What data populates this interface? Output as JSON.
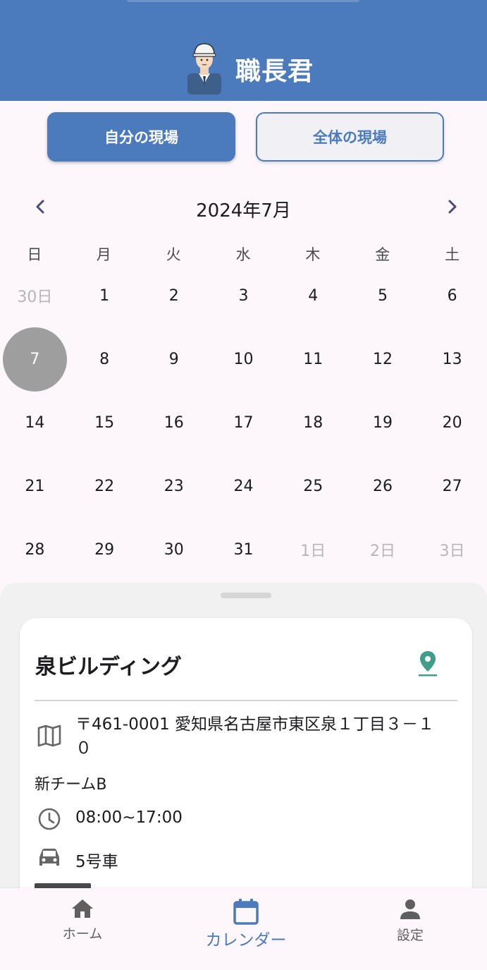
{
  "header": {
    "title": "職長君",
    "avatar_icon": "construction-worker-avatar-icon"
  },
  "tabs": {
    "mine": "自分の現場",
    "all": "全体の現場"
  },
  "calendar": {
    "month_label": "2024年7月",
    "prev_icon": "chevron-left-icon",
    "next_icon": "chevron-right-icon",
    "weekdays": [
      "日",
      "月",
      "火",
      "水",
      "木",
      "金",
      "土"
    ],
    "weeks": [
      [
        {
          "d": "30日",
          "other": true
        },
        {
          "d": "1"
        },
        {
          "d": "2"
        },
        {
          "d": "3"
        },
        {
          "d": "4"
        },
        {
          "d": "5"
        },
        {
          "d": "6"
        }
      ],
      [
        {
          "d": "7",
          "selected": true
        },
        {
          "d": "8"
        },
        {
          "d": "9"
        },
        {
          "d": "10"
        },
        {
          "d": "11"
        },
        {
          "d": "12"
        },
        {
          "d": "13"
        }
      ],
      [
        {
          "d": "14"
        },
        {
          "d": "15"
        },
        {
          "d": "16"
        },
        {
          "d": "17"
        },
        {
          "d": "18"
        },
        {
          "d": "19"
        },
        {
          "d": "20"
        }
      ],
      [
        {
          "d": "21"
        },
        {
          "d": "22"
        },
        {
          "d": "23"
        },
        {
          "d": "24"
        },
        {
          "d": "25"
        },
        {
          "d": "26"
        },
        {
          "d": "27"
        }
      ],
      [
        {
          "d": "28"
        },
        {
          "d": "29"
        },
        {
          "d": "30"
        },
        {
          "d": "31"
        },
        {
          "d": "1日",
          "other": true
        },
        {
          "d": "2日",
          "other": true
        },
        {
          "d": "3日",
          "other": true
        }
      ]
    ]
  },
  "site": {
    "name": "泉ビルディング",
    "address": "〒461-0001 愛知県名古屋市東区泉１丁目３－１０",
    "team": "新チームB",
    "hours": "08:00~17:00",
    "vehicle": "5号車"
  },
  "nav": {
    "home": "ホーム",
    "calendar": "カレンダー",
    "settings": "設定"
  },
  "colors": {
    "primary": "#4b7bbd",
    "pin": "#3f9d8a",
    "selected_day": "#9e9e9e"
  }
}
